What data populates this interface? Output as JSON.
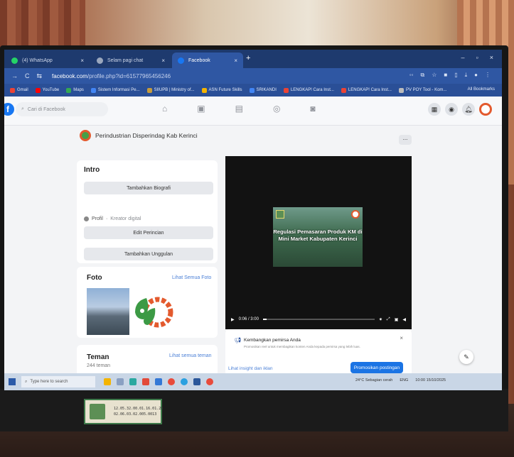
{
  "browser": {
    "tabs": [
      {
        "label": "(4) WhatsApp",
        "color": "#25d366"
      },
      {
        "label": "Selam pagi chat",
        "color": "#9aa7bd"
      },
      {
        "label": "Facebook",
        "color": "#1877f2"
      }
    ],
    "url_host": "facebook.com",
    "url_path": "/profile.php?id=61577965456246",
    "bookmarks": [
      {
        "label": "Gmail",
        "color": "#ea4335"
      },
      {
        "label": "YouTube",
        "color": "#ff0000"
      },
      {
        "label": "Maps",
        "color": "#34a853"
      },
      {
        "label": "Sistem Informasi Pe...",
        "color": "#4285f4"
      },
      {
        "label": "SIIUPB | Ministry of...",
        "color": "#c69c3c"
      },
      {
        "label": "ASN Future Skills",
        "color": "#f4b400"
      },
      {
        "label": "SRIKANDI",
        "color": "#4285f4"
      },
      {
        "label": "LENGKAP! Cara Inst...",
        "color": "#ea4335"
      },
      {
        "label": "LENGKAP! Cara Inst...",
        "color": "#ea4335"
      },
      {
        "label": "PV POY Tool - Kom...",
        "color": "#bbbbbb"
      }
    ],
    "all_bookmarks": "All Bookmarks"
  },
  "facebook": {
    "search_placeholder": "Cari di Facebook",
    "page_name": "Perindustrian Disperindag Kab Kerinci",
    "more": "...",
    "intro": {
      "title": "Intro",
      "add_bio": "Tambahkan Biografi",
      "profile_label": "Profil",
      "profile_category": "Kreator digital",
      "edit_details": "Edit Perincian",
      "add_featured": "Tambahkan Unggulan"
    },
    "photos": {
      "title": "Foto",
      "see_all": "Lihat Semua Foto"
    },
    "friends": {
      "title": "Teman",
      "count": "244 teman",
      "see_all": "Lihat semua teman"
    },
    "video": {
      "title": "Regulasi Pemasaran Produk KM di Mini Market Kabupaten Kerinci",
      "time": "0:06 / 3:00",
      "progress": 0.03
    },
    "promo": {
      "title": "Kembangkan pemirsa Anda",
      "text": "Promosikan reel untuk membagikan konten Anda kepada pemirsa yang lebih luas.",
      "insight": "Lihat insight dan iklan",
      "button": "Promosikan postingan"
    }
  },
  "taskbar": {
    "search_placeholder": "Type here to search",
    "weather": "24°C Sebagian cerah",
    "lang": "ENG",
    "time": "10:00",
    "date": "15/10/2025"
  },
  "sticker": {
    "line1": "12.05.32.00.01.16.01.20",
    "line2": "02.06.03.02.005.0013"
  }
}
